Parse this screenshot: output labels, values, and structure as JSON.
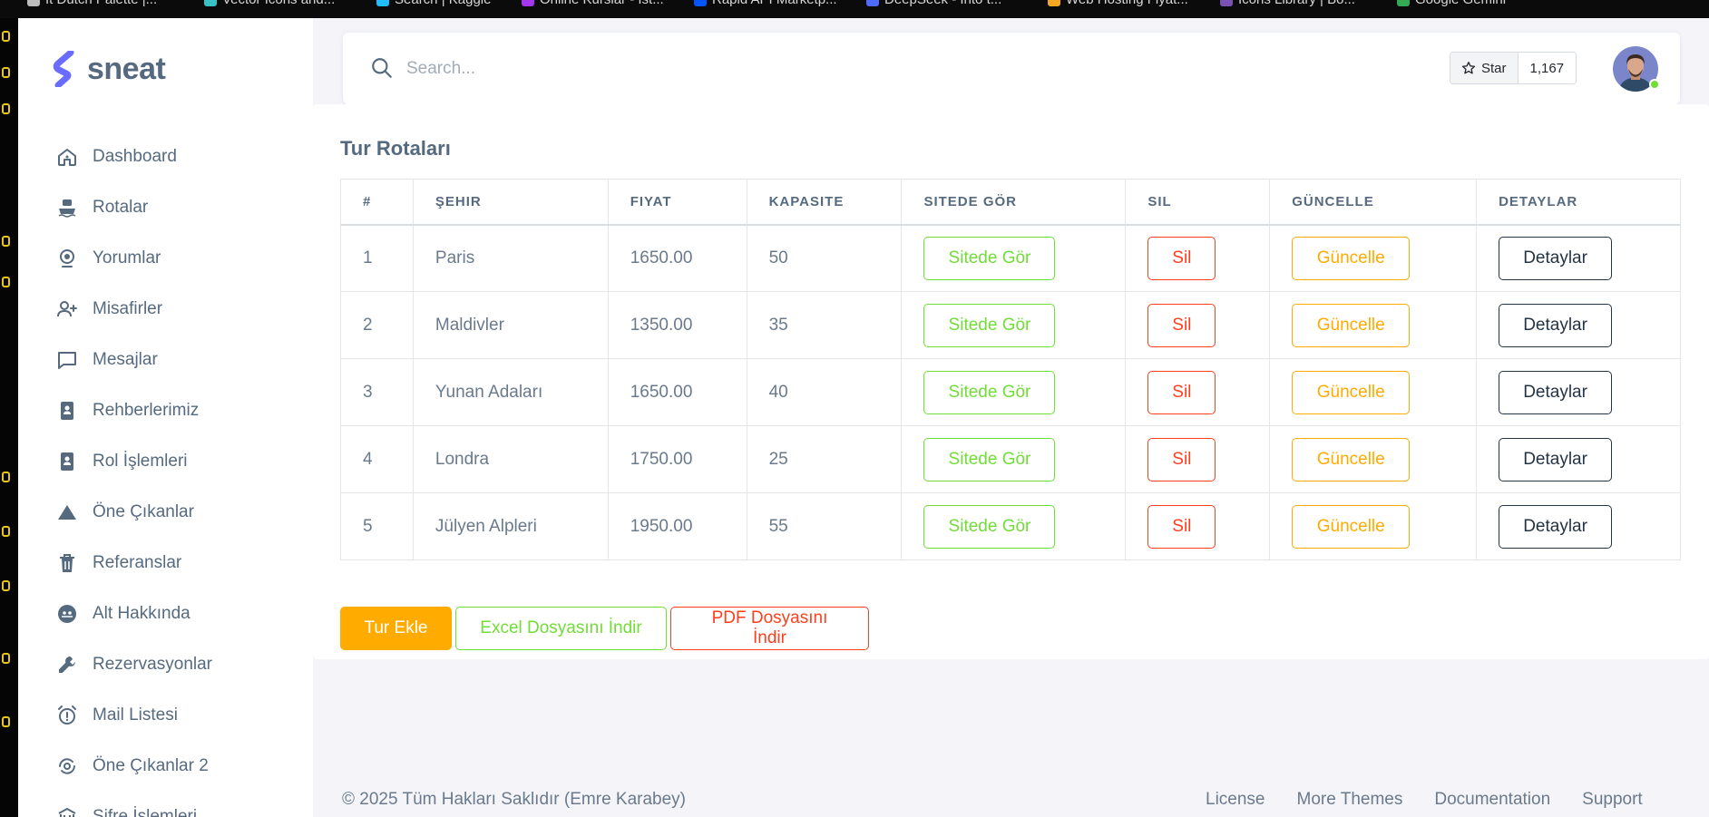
{
  "bookmarks": [
    {
      "label": "It Dutch Palette |...",
      "color": "#bdbdbd"
    },
    {
      "label": "Vector Icons and...",
      "color": "#37c2c8"
    },
    {
      "label": "Search | Kaggle",
      "color": "#20beff"
    },
    {
      "label": "Online Kurslar - Ist...",
      "color": "#a435f0"
    },
    {
      "label": "Rapid API Marketp...",
      "color": "#0055ff"
    },
    {
      "label": "DeepSeek - Into t...",
      "color": "#4d6bfe"
    },
    {
      "label": "Web Hosting Fiyat...",
      "color": "#f5a623"
    },
    {
      "label": "Icons Library | Bo...",
      "color": "#7952b3"
    },
    {
      "label": "Google Gemini",
      "color": "#34a853"
    }
  ],
  "brand": {
    "name": "sneat",
    "color": "#696cff"
  },
  "sidebar": {
    "items": [
      {
        "label": "Dashboard",
        "icon": "home-icon"
      },
      {
        "label": "Rotalar",
        "icon": "ship-icon"
      },
      {
        "label": "Yorumlar",
        "icon": "webcam-icon"
      },
      {
        "label": "Misafirler",
        "icon": "user-plus-icon"
      },
      {
        "label": "Mesajlar",
        "icon": "message-icon"
      },
      {
        "label": "Rehberlerimiz",
        "icon": "id-badge-icon"
      },
      {
        "label": "Rol İşlemleri",
        "icon": "id-badge-icon"
      },
      {
        "label": "Öne Çıkanlar",
        "icon": "triangle-icon"
      },
      {
        "label": "Referanslar",
        "icon": "trash-icon"
      },
      {
        "label": "Alt Hakkında",
        "icon": "ghost-icon"
      },
      {
        "label": "Rezervasyonlar",
        "icon": "wrench-icon"
      },
      {
        "label": "Mail Listesi",
        "icon": "alarm-exclamation-icon"
      },
      {
        "label": "Öne Çıkanlar 2",
        "icon": "search-cycle-icon"
      },
      {
        "label": "Şifre İşlemleri",
        "icon": "building-icon"
      }
    ]
  },
  "navbar": {
    "search_placeholder": "Search...",
    "star_label": "Star",
    "star_count": "1,167"
  },
  "page": {
    "title": "Tur Rotaları",
    "columns": [
      "#",
      "ŞEHIR",
      "FIYAT",
      "KAPASITE",
      "SITEDE GÖR",
      "SIL",
      "GÜNCELLE",
      "DETAYLAR"
    ],
    "rows": [
      {
        "no": "1",
        "city": "Paris",
        "price": "1650.00",
        "capacity": "50"
      },
      {
        "no": "2",
        "city": "Maldivler",
        "price": "1350.00",
        "capacity": "35"
      },
      {
        "no": "3",
        "city": "Yunan Adaları",
        "price": "1650.00",
        "capacity": "40"
      },
      {
        "no": "4",
        "city": "Londra",
        "price": "1750.00",
        "capacity": "25"
      },
      {
        "no": "5",
        "city": "Jülyen Alpleri",
        "price": "1950.00",
        "capacity": "55"
      }
    ],
    "row_buttons": {
      "view": "Sitede Gör",
      "delete": "Sil",
      "update": "Güncelle",
      "details": "Detaylar"
    },
    "actions": {
      "add": "Tur Ekle",
      "excel": "Excel Dosyasını İndir",
      "pdf": "PDF Dosyasını İndir"
    }
  },
  "footer": {
    "copyright": "© 2025 Tüm Hakları Saklıdır (Emre Karabey)",
    "links": [
      "License",
      "More Themes",
      "Documentation",
      "Support"
    ]
  },
  "colors": {
    "success": "#71dd37",
    "danger": "#ff3e1d",
    "warning": "#ffab00",
    "dark": "#233446",
    "text": "#566a7f"
  }
}
